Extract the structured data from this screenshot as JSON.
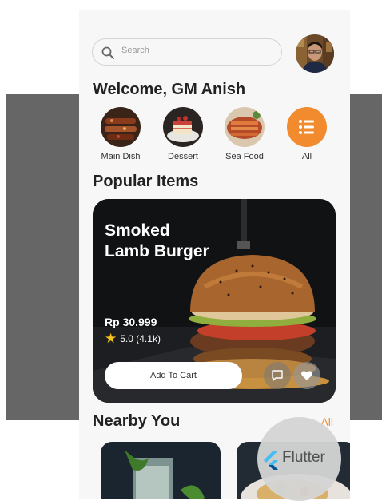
{
  "search": {
    "placeholder": "Search"
  },
  "header": {
    "welcome": "Welcome, GM Anish"
  },
  "categories": [
    {
      "label": "Main Dish",
      "icon": "main-dish-photo"
    },
    {
      "label": "Dessert",
      "icon": "dessert-photo"
    },
    {
      "label": "Sea Food",
      "icon": "sea-food-photo"
    },
    {
      "label": "All",
      "icon": "list-icon"
    }
  ],
  "popular": {
    "title": "Popular Items",
    "card": {
      "name": "Smoked Lamb Burger",
      "price": "Rp 30.999",
      "rating": "5.0 (4.1k)",
      "add_label": "Add To Cart"
    }
  },
  "nearby": {
    "title": "Nearby You",
    "see_all": "All"
  },
  "badge": {
    "label": "Flutter"
  },
  "colors": {
    "accent": "#f28a2e",
    "star": "#f6c21c",
    "band": "#666666"
  }
}
